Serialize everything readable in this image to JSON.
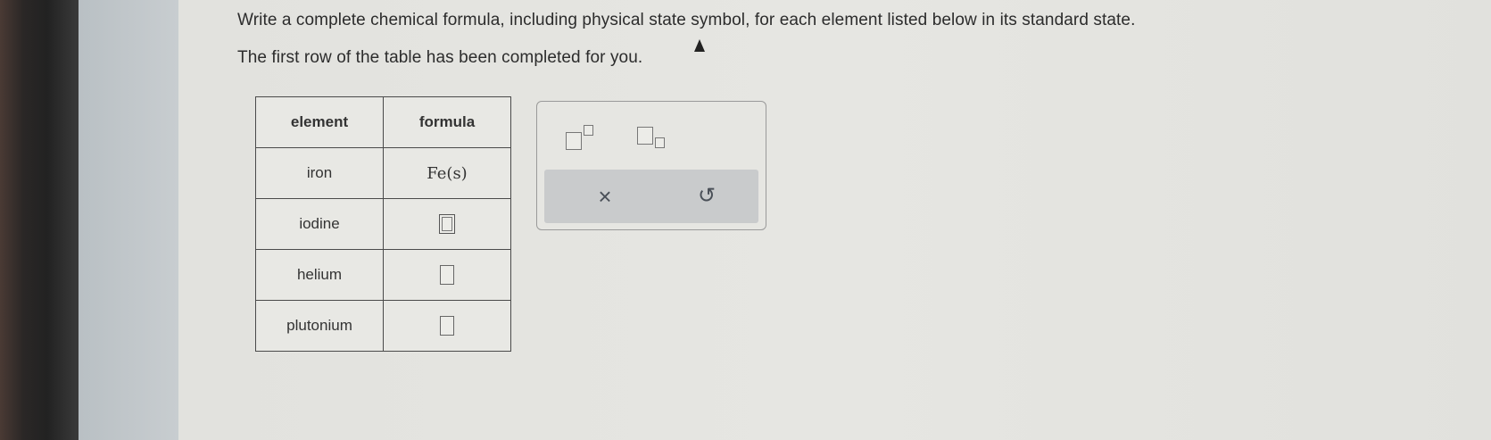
{
  "instructions": {
    "line1": "Write a complete chemical formula, including physical state symbol, for each element listed below in its standard state.",
    "line2": "The first row of the table has been completed for you."
  },
  "table": {
    "headers": [
      "element",
      "formula"
    ],
    "rows": [
      {
        "element": "iron",
        "formula": "Fe(s)"
      },
      {
        "element": "iodine",
        "formula": ""
      },
      {
        "element": "helium",
        "formula": ""
      },
      {
        "element": "plutonium",
        "formula": ""
      }
    ]
  },
  "palette": {
    "superscript_icon": "superscript-template-icon",
    "subscript_icon": "subscript-template-icon",
    "clear_label": "×",
    "undo_label": "↺"
  }
}
